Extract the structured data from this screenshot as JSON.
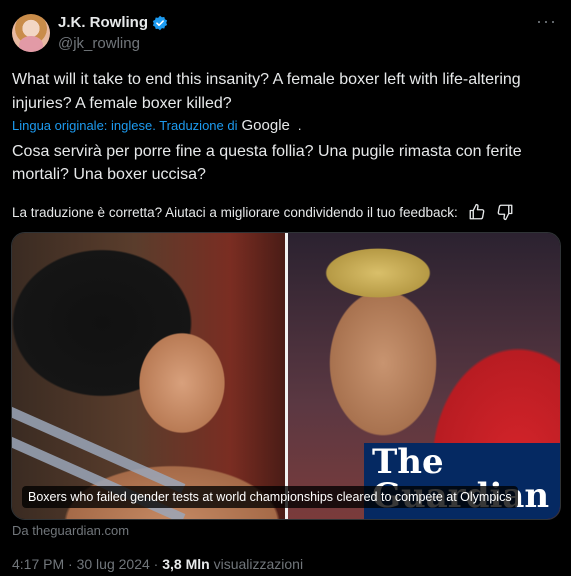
{
  "author": {
    "display_name": "J.K. Rowling",
    "handle": "@jk_rowling",
    "verified_icon": "verified-badge-icon"
  },
  "more_label": "···",
  "text": "What will it take to end this insanity? A  female boxer left with life-altering injuries? A female boxer killed?",
  "translation": {
    "meta": "Lingua originale: inglese. Traduzione di",
    "provider": "Google",
    "dot": ".",
    "text": "Cosa servirà per porre fine a questa follia? Una pugile rimasta con ferite mortali? Una boxer uccisa?"
  },
  "feedback": {
    "prompt": "La traduzione è corretta? Aiutaci a migliorare condividendo il tuo feedback:",
    "icons": [
      "thumbs-up-icon",
      "thumbs-down-icon"
    ]
  },
  "card": {
    "brand": "The Guardian",
    "caption": "Boxers who failed gender tests at world championships cleared to compete at Olympics",
    "source": "Da theguardian.com"
  },
  "meta": {
    "time": "4:17 PM",
    "date": "30 lug 2024",
    "separator": "·",
    "views_count": "3,8 Mln",
    "views_label": "visualizzazioni"
  },
  "colors": {
    "background": "#000000",
    "text": "#e7e9ea",
    "muted": "#71767b",
    "link": "#1d9bf0",
    "guardian_blue": "#052962"
  }
}
